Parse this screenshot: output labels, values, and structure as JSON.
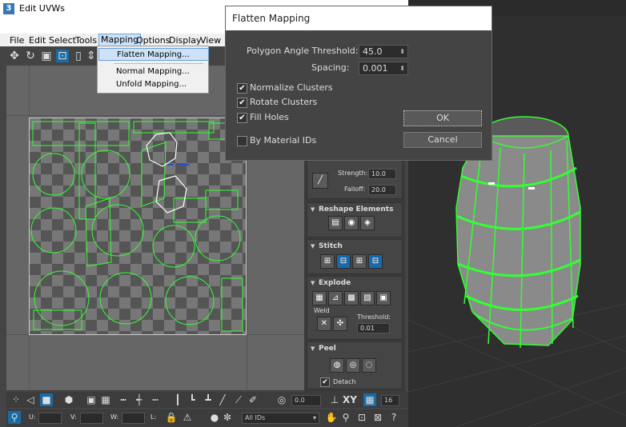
{
  "window": {
    "app_icon": "3",
    "title": "Edit UVWs"
  },
  "menubar": {
    "items": [
      "File",
      "Edit",
      "Select",
      "Tools",
      "Mapping",
      "Options",
      "Display",
      "View"
    ]
  },
  "mapping_menu": {
    "items": [
      "Flatten Mapping...",
      "Normal Mapping...",
      "Unfold Mapping..."
    ]
  },
  "dialog": {
    "title": "Flatten Mapping",
    "polygon_angle_threshold_label": "Polygon Angle Threshold:",
    "polygon_angle_threshold_value": "45.0",
    "spacing_label": "Spacing:",
    "spacing_value": "0.001",
    "normalize_clusters_label": "Normalize Clusters",
    "normalize_clusters_checked": true,
    "rotate_clusters_label": "Rotate Clusters",
    "rotate_clusters_checked": true,
    "fill_holes_label": "Fill Holes",
    "fill_holes_checked": true,
    "by_material_ids_label": "By Material IDs",
    "by_material_ids_checked": false,
    "ok_label": "OK",
    "cancel_label": "Cancel"
  },
  "command_panel": {
    "strength_label": "Strength:",
    "strength_value": "10.0",
    "falloff_label": "Falloff:",
    "falloff_value": "20.0",
    "reshape_title": "Reshape Elements",
    "stitch_title": "Stitch",
    "explode_title": "Explode",
    "weld_label": "Weld",
    "threshold_label": "Threshold:",
    "threshold_value": "0.01",
    "peel_title": "Peel",
    "detach_label": "Detach"
  },
  "bottom_bar": {
    "spin_value": "0.0",
    "xy_label": "XY",
    "grid_value": "16",
    "u_label": "U:",
    "v_label": "V:",
    "w_label": "W:",
    "l_label": "L:",
    "ids_value": "All IDs"
  },
  "colors": {
    "uv_wire": "#33ff33",
    "accent": "#1a6aa5",
    "selection": "#ffffff"
  }
}
